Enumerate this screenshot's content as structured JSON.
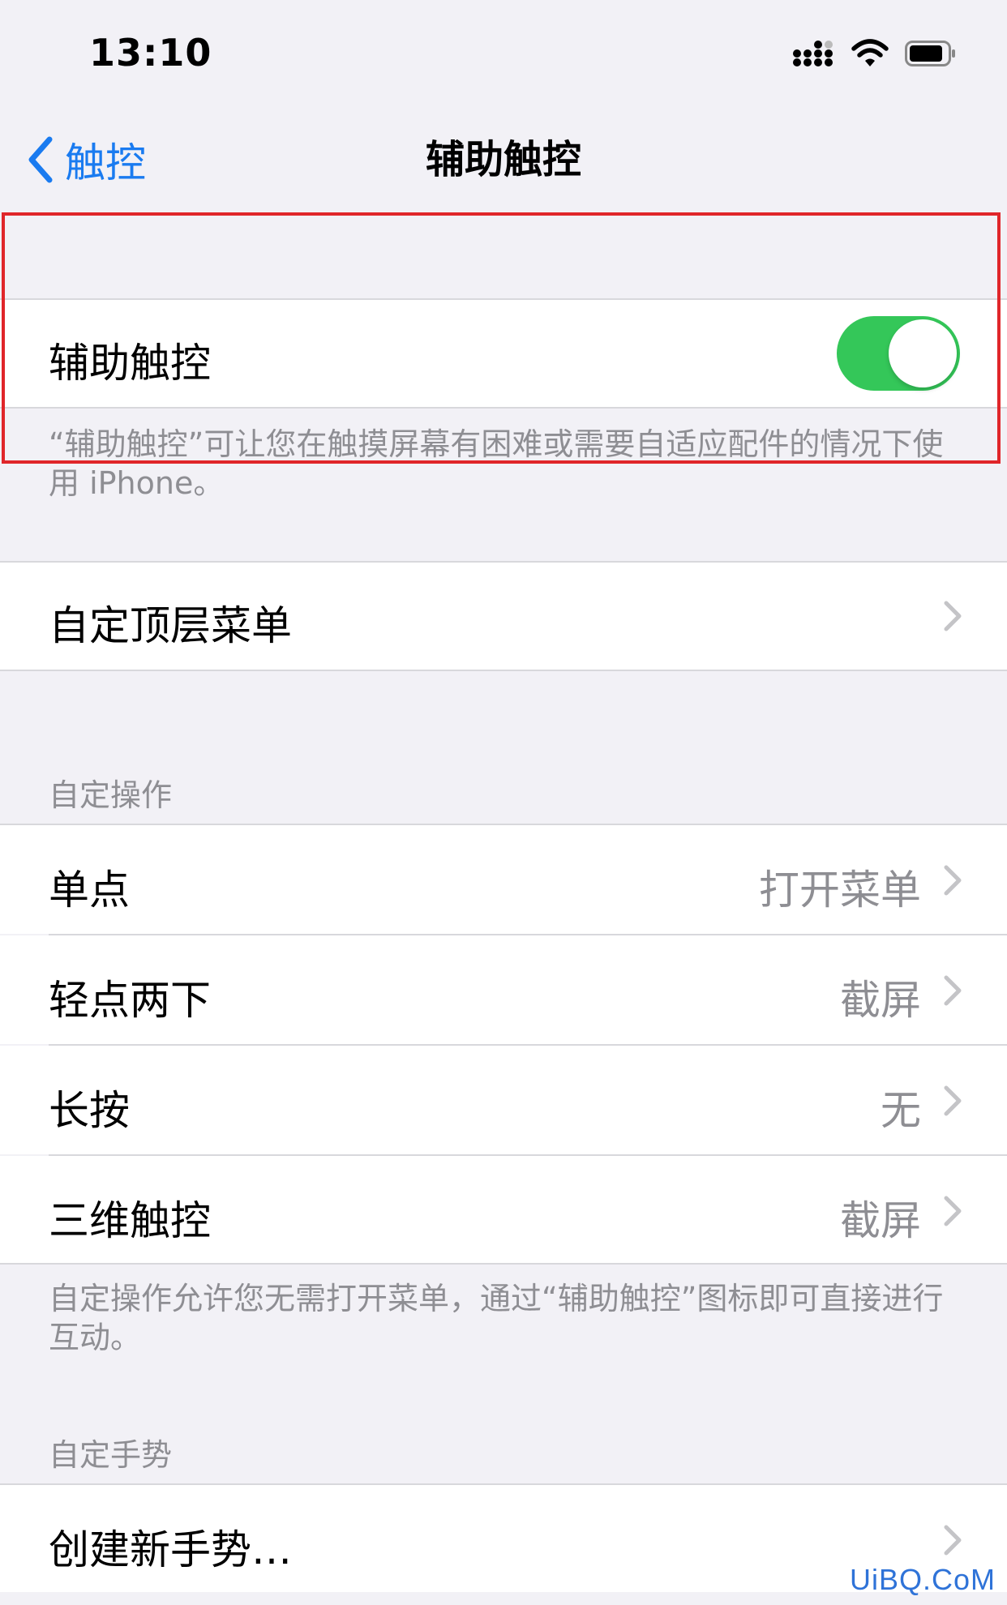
{
  "status_bar": {
    "time": "13:10",
    "icons": [
      "cellular-signal-icon",
      "wifi-icon",
      "battery-icon"
    ]
  },
  "nav": {
    "back_label": "触控",
    "title": "辅助触控"
  },
  "main_toggle": {
    "label": "辅助触控",
    "enabled": true,
    "footnote": "“辅助触控”可让您在触摸屏幕有困难或需要自适应配件的情况下使用 iPhone。"
  },
  "top_menu": {
    "label": "自定顶层菜单"
  },
  "custom_actions": {
    "header": "自定操作",
    "items": [
      {
        "label": "单点",
        "value": "打开菜单"
      },
      {
        "label": "轻点两下",
        "value": "截屏"
      },
      {
        "label": "长按",
        "value": "无"
      },
      {
        "label": "三维触控",
        "value": "截屏"
      }
    ],
    "footnote": "自定操作允许您无需打开菜单，通过“辅助触控”图标即可直接进行互动。"
  },
  "custom_gestures": {
    "header": "自定手势",
    "create_label": "创建新手势…"
  },
  "watermark": "UiBQ.CoM",
  "colors": {
    "accent": "#1a7bf0",
    "switch_on": "#34c759",
    "highlight_box": "#e0262a",
    "background": "#f2f1f6"
  }
}
